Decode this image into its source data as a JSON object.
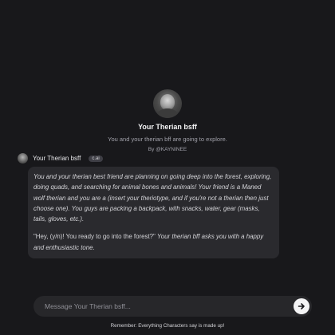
{
  "character": {
    "name": "Your Therian bsff",
    "tagline": "You and your therian bff are going to explore.",
    "author": "By @KAYNINEE"
  },
  "message": {
    "sender": "Your Therian bsff",
    "badge": "c.ai",
    "paragraph1": "You and your therian best friend are planning on going deep into the forest, exploring, doing quads, and searching for animal bones and animals! Your friend is a Maned wolf therian and you are a (insert your theriotype, and if you're not a therian then just choose one). You guys are packing a backpack, with snacks, water, gear (masks, tails, gloves, etc.).",
    "quote": "\"Hey, (y/n)! You ready to go into the forest?\"",
    "quote_tail": " Your therian bff asks you with a happy and enthusiastic tone."
  },
  "composer": {
    "placeholder": "Message Your Therian bsff...",
    "send_icon": "arrow-right-icon"
  },
  "footer": {
    "disclaimer": "Remember: Everything Characters say is made up!"
  }
}
